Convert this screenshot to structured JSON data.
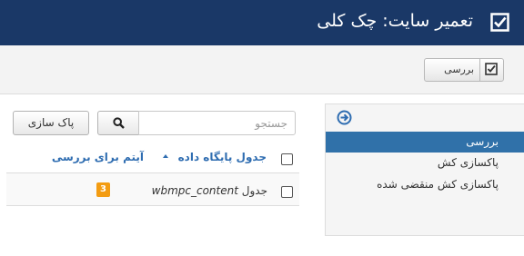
{
  "header": {
    "title": "تعمیر سایت: چک کلی",
    "icon": "checkbox-checked-icon"
  },
  "toolbar": {
    "check_button_label": "بررسی",
    "check_button_icon": "checkbox-checked-icon"
  },
  "sidebar": {
    "toggle_icon": "circle-arrow-right-icon",
    "items": [
      {
        "label": "بررسی",
        "active": true
      },
      {
        "label": "پاکسازی کش",
        "active": false
      },
      {
        "label": "پاکسازی کش منقضی شده",
        "active": false
      }
    ]
  },
  "search": {
    "placeholder": "جستجو",
    "value": "",
    "clear_label": "پاک سازی",
    "search_icon": "search-icon"
  },
  "table": {
    "columns": {
      "table_name": "جدول پایگاه داده",
      "items_to_check": "آیتم برای بررسی"
    },
    "sort_icon": "sort-asc-icon",
    "rows": [
      {
        "table_prefix": "جدول",
        "table_name": "wbmpc_content",
        "count": "3"
      }
    ]
  },
  "colors": {
    "header_bg": "#1a3867",
    "active_item": "#3071a9",
    "link": "#2f6db1",
    "badge": "#f39c12"
  }
}
